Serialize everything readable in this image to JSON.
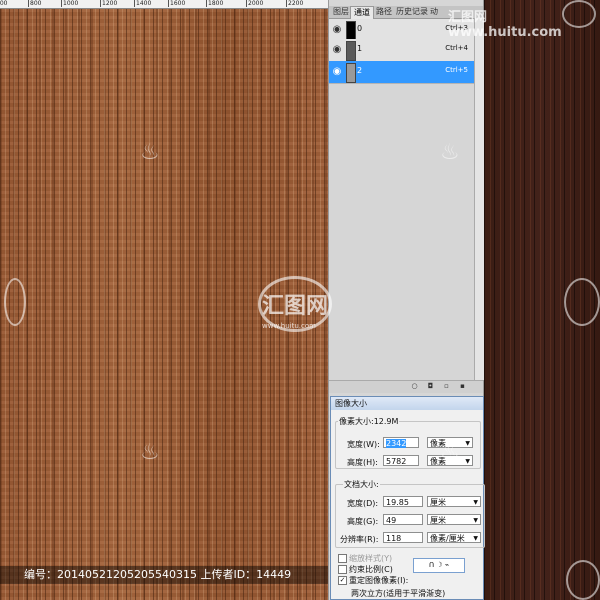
{
  "ruler": {
    "ticks": [
      "600",
      "800",
      "1000",
      "1200",
      "1400",
      "1600",
      "1800",
      "2000",
      "2200"
    ]
  },
  "panel": {
    "tabs": [
      "图层",
      "通道",
      "路径",
      "历史记录",
      "动"
    ],
    "active_tab": "通道",
    "channels": [
      {
        "name": "0",
        "shortcut": "Ctrl+3",
        "thumb_color": "#000000",
        "selected": false
      },
      {
        "name": "1",
        "shortcut": "Ctrl+4",
        "thumb_color": "#5a5a5a",
        "selected": false
      },
      {
        "name": "2",
        "shortcut": "Ctrl+5",
        "thumb_color": "#9a9a9a",
        "selected": true
      }
    ],
    "selected_color": "#3399ff",
    "footer_icons": [
      "dotted-circle-icon",
      "save-selection-icon",
      "new-channel-icon",
      "trash-icon"
    ]
  },
  "dialog": {
    "title": "图像大小",
    "pixel_dimensions_label": "像素大小:12.9M",
    "width_label": "宽度(W):",
    "width_value": "2342",
    "width_unit": "像素",
    "height_label": "高度(H):",
    "height_value": "5782",
    "height_unit": "像素",
    "document_size_label": "文档大小:",
    "doc_width_label": "宽度(D):",
    "doc_width_value": "19.85",
    "doc_width_unit": "厘米",
    "doc_height_label": "高度(G):",
    "doc_height_value": "49",
    "doc_height_unit": "厘米",
    "resolution_label": "分辨率(R):",
    "resolution_value": "118",
    "resolution_unit": "像素/厘米",
    "scale_styles_label": "缩放样式(Y)",
    "constrain_label": "约束比例(C)",
    "resample_label": "重定图像像素(I):",
    "resample_method": "两次立方(适用于平滑渐变)",
    "scale_styles_checked": false,
    "constrain_checked": false,
    "resample_checked": true
  },
  "watermark": {
    "meta_text": "编号：20140521205205540315 上传者ID：14449",
    "site_text": "汇图网 www.huitu.com",
    "logo_text": "汇图网",
    "logo_url": "www.huitu.com"
  },
  "colors": {
    "light_wood": "#a2613a",
    "dark_wood": "#3e1f16"
  }
}
